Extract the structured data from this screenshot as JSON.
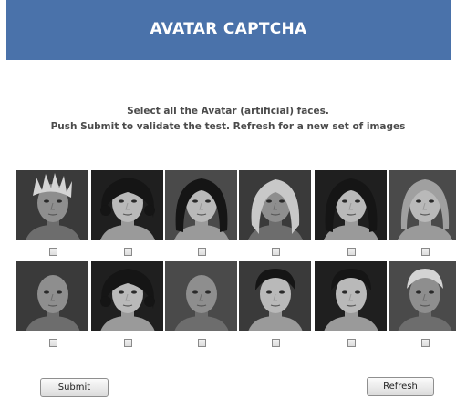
{
  "header": {
    "title": "AVATAR CAPTCHA"
  },
  "instructions": {
    "line1": "Select all the Avatar (artificial) faces.",
    "line2": "Push Submit to validate the test. Refresh for a new set of images"
  },
  "images": [
    {
      "kind": "avatar",
      "hair": "spiky light",
      "checked": false
    },
    {
      "kind": "human",
      "hair": "dark curly",
      "checked": false
    },
    {
      "kind": "human",
      "hair": "dark",
      "checked": false
    },
    {
      "kind": "avatar",
      "hair": "blonde long",
      "checked": false
    },
    {
      "kind": "human",
      "hair": "dark",
      "checked": false
    },
    {
      "kind": "human",
      "hair": "light",
      "checked": false
    },
    {
      "kind": "avatar",
      "hair": "bald",
      "checked": false
    },
    {
      "kind": "human",
      "hair": "dark curly",
      "checked": false
    },
    {
      "kind": "avatar",
      "hair": "bald",
      "checked": false
    },
    {
      "kind": "human",
      "hair": "dark short",
      "checked": false
    },
    {
      "kind": "human",
      "hair": "dark short",
      "checked": false
    },
    {
      "kind": "avatar",
      "hair": "short light",
      "checked": false
    }
  ],
  "buttons": {
    "submit": "Submit",
    "refresh": "Refresh"
  }
}
